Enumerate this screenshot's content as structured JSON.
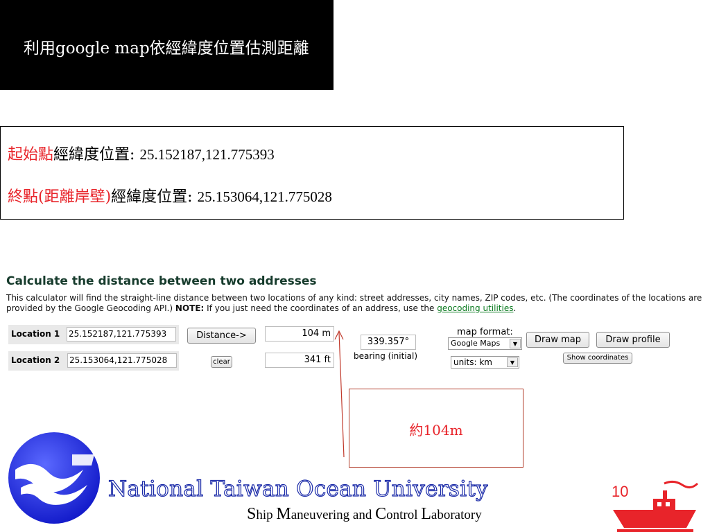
{
  "slide": {
    "title": "利用google map依經緯度位置估測距離",
    "page_number": "10"
  },
  "coordinates": {
    "start_label_red": "起始點",
    "start_label": "經緯度位置:",
    "start_value": "25.152187,121.775393",
    "end_label_red": "終點(距離岸壁)",
    "end_label": "經緯度位置:",
    "end_value": "25.153064,121.775028"
  },
  "calculator": {
    "heading": "Calculate the distance between two addresses",
    "description_prefix": "This calculator will find the straight-line distance between two locations of any kind: street addresses, city names, ZIP codes, etc. (The coordinates of the locations are provided by the Google Geocoding API.) ",
    "note_label": "NOTE:",
    "description_suffix": " If you just need the coordinates of an address, use the ",
    "geocoding_link": "geocoding utilities",
    "description_end": ".",
    "location1_label": "Location 1",
    "location1_value": "25.152187,121.775393",
    "location2_label": "Location 2",
    "location2_value": "25.153064,121.775028",
    "distance_button": "Distance->",
    "clear_button": "clear",
    "distance_m": "104 m",
    "distance_ft": "341 ft",
    "bearing_value": "339.357°",
    "bearing_label": "bearing (initial)",
    "map_format_label": "map format:",
    "map_format_selected": "Google Maps",
    "units_selected": "units: km",
    "draw_map_button": "Draw map",
    "draw_profile_button": "Draw profile",
    "show_coordinates_button": "Show coordinates"
  },
  "annotation": {
    "text": "約104m"
  },
  "footer": {
    "university": "National Taiwan Ocean University",
    "lab_S": "S",
    "lab_hip": "hip ",
    "lab_M": "M",
    "lab_aneuvering": "aneuvering and ",
    "lab_C": "C",
    "lab_ontrol": "ontrol ",
    "lab_L": "L",
    "lab_aboratory": "aboratory"
  },
  "colors": {
    "accent_red": "#e8242a",
    "heading_green": "#163b2c",
    "link_green": "#0a7a1f",
    "logo_blue": "#1a2aa8"
  }
}
